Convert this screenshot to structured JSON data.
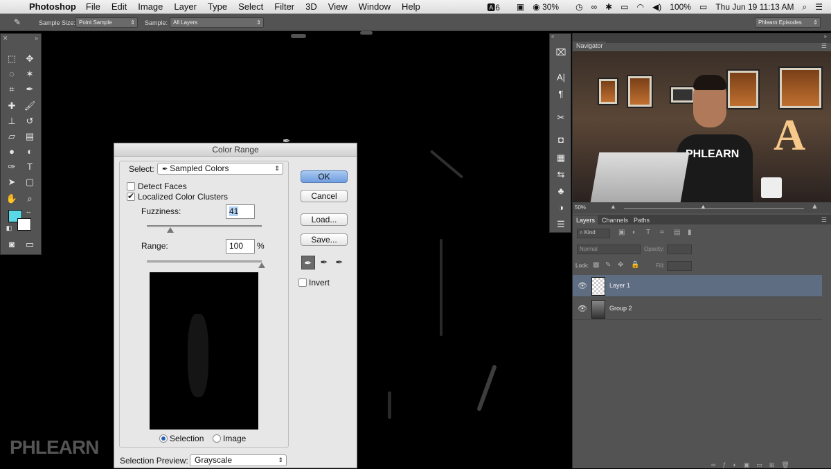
{
  "menubar": {
    "app_name": "Photoshop",
    "menus": [
      "File",
      "Edit",
      "Image",
      "Layer",
      "Type",
      "Select",
      "Filter",
      "3D",
      "View",
      "Window",
      "Help"
    ],
    "status": {
      "notifications": "6",
      "battery_icon_text": "30%",
      "battery": "100%",
      "datetime": "Thu Jun 19  11:13 AM"
    }
  },
  "options_bar": {
    "sample_size_label": "Sample Size:",
    "sample_size_value": "Point Sample",
    "sample_label": "Sample:",
    "sample_value": "All Layers",
    "workspace": "Phlearn Episodes"
  },
  "dialog": {
    "title": "Color Range",
    "select_label": "Select:",
    "select_value": "Sampled Colors",
    "detect_faces": "Detect Faces",
    "localized_clusters": "Localized Color Clusters",
    "localized_checked": true,
    "fuzziness_label": "Fuzziness:",
    "fuzziness_value": "41",
    "fuzziness_level": 0.41,
    "range_label": "Range:",
    "range_value": "100",
    "range_unit": "%",
    "range_level": 1.0,
    "selection_radio": "Selection",
    "image_radio": "Image",
    "preview_label": "Selection Preview:",
    "preview_value": "Grayscale",
    "buttons": {
      "ok": "OK",
      "cancel": "Cancel",
      "load": "Load...",
      "save": "Save..."
    },
    "invert": "Invert"
  },
  "navigator": {
    "tab": "Navigator",
    "zoom": "50%",
    "shirt_text": "PHLEARN",
    "sign_letter": "A"
  },
  "layers_panel": {
    "tabs": [
      "Layers",
      "Channels",
      "Paths"
    ],
    "filter": "Kind",
    "blend_mode": "Normal",
    "opacity_label": "Opacity:",
    "lock_label": "Lock:",
    "fill_label": "Fill:",
    "layers": [
      {
        "name": "Layer 1",
        "selected": true
      },
      {
        "name": "Group 2",
        "selected": false
      }
    ]
  },
  "watermark": "PHLEARN",
  "colors": {
    "foreground": "#5ad8e6",
    "background": "#ffffff",
    "selected_layer": "#5f6d82"
  }
}
